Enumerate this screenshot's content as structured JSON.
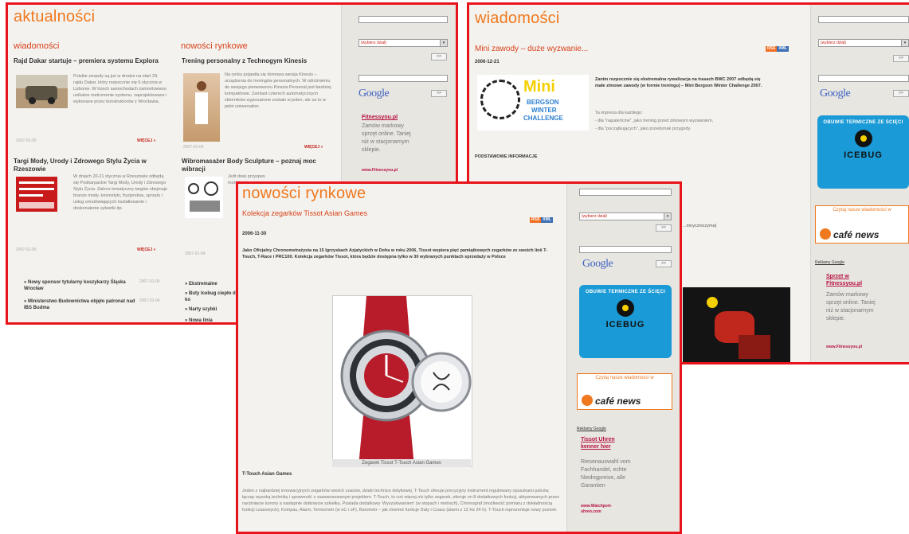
{
  "aktualnosci": {
    "title": "aktualności",
    "col_left_title": "wiadomości",
    "col_right_title": "nowości rynkowe",
    "articles_left": [
      {
        "title": "Rajd Dakar startuje – premiera systemu Explora",
        "body": "Polskie zespoły są już w drodze na start 29. rajdu Dakar, który rozpocznie się 6 stycznia w Lizbonie. W trzech samochodach zamontowano unikalne metronomie systemu, zaprojektowane i wykonane przez konstruktorów z Wrocławia.",
        "date": "2007-01-05",
        "more": "WIĘCEJ »"
      },
      {
        "title": "Targi Mody, Urody i Zdrowego Stylu Życia w Rzeszowie",
        "body": "W dniach 20-21 stycznia w Rzeszowie odbędą się Podkarpackie Targi Mody, Urody i Zdrowego Stylu Życia. Zakres tematyczny targów obejmuje branże mody, kosmetyki, fryzjerstwa, sprzętu i usług umożliwiających kształtowanie i doskonalenie sylwetki itp.",
        "date": "2007-01-05",
        "more": "WIĘCEJ »"
      }
    ],
    "articles_right": [
      {
        "title": "Trening personalny z Technogym Kinesis",
        "body": "Na rynku pojawiła się domowa wersja Kinesis – urządzenia do treningów personalnych. W odróżnieniu do swojego pierwowzoru Kinesis Personal jest bardziej kompaktowe. Zamiast czterech automatycznych zbiorników wyposażone zostało w jeden, ale za to w pełni uniwersalne.",
        "date": "2007-01-05",
        "more": "WIĘCEJ »"
      },
      {
        "title": "Wibromasażer Body Sculpture – poznaj moc wibracji",
        "body": "Jedt dowi przyspes moni trening mia ssowanie powered za pomocą po wibracji ale pomocą uny...",
        "date": "2007-01-04",
        "more": ""
      }
    ],
    "list_left": [
      {
        "text": "Nowy sponsor tytularny koszykarzy Śląska Wrocław",
        "date": "2007-01-04"
      },
      {
        "text": "Ministerstwo Budownictwa objęło patronat nad IBS Budma",
        "date": "2007-01-04"
      }
    ],
    "list_right": [
      "Ekstremalne",
      "Buty Icebug ciepło dla ko",
      "Narty szybki",
      "Nowa linia"
    ],
    "ad": {
      "link": "Fitnessyou.pl",
      "text": "Zamów markowy sprzęt online. Taniej niż w stacjonarnym sklepie.",
      "url": "www.Fitnessyou.pl"
    },
    "select_label": "(wybierz dział)",
    "go": ">>",
    "google": "Google"
  },
  "wiadomosci": {
    "title": "wiadomości",
    "article_title": "Mini zawody – duże wyzwanie...",
    "rss": [
      "RSS",
      "XML"
    ],
    "date": "2006-12-21",
    "lead": "Zanim rozpocznie się ekstremalna rywalizacja na trasach BWC 2007 odbędą się małe zimowe zawody (w formie treningu) – Mini Bergson Winter Challenge 2007.",
    "bullets": [
      "Ta impreza dla każdego:",
      "- dla \"napaleńców\", jako trening przed zimowym wyzwaniem,",
      "- dla \"początkujących\", jako przedsmak przygody."
    ],
    "section": "PODSTAWOWE INFORMACJE",
    "mini_logo": [
      "Mini",
      "BERGSON",
      "WINTER",
      "CHALLENGE"
    ],
    "icebug": {
      "top": "OBUWIE TERMICZNE ZE ŚCIĘCI",
      "brand": "ICEBUG"
    },
    "cafe": {
      "line": "Czytaj nasze wiadomości w",
      "name": "café news"
    },
    "ad_label": "Reklamy Google",
    "ad": {
      "link": "Sprzęt w Fitnessyou.pl",
      "text": "Zamów markowy sprzęt online. Taniej niż w stacjonarnym sklepie.",
      "url": "www.Fitnessyou.pl"
    },
    "partial_text": "...mnyczniczyma)"
  },
  "nowosci": {
    "title": "nowości rynkowe",
    "article_title": "Kolekcja zegarków Tissot Asian Games",
    "rss": [
      "RSS",
      "XML"
    ],
    "date": "2006-11-30",
    "lead": "Jako Oficjalny Chronometrażysta na 15 Igrzyskach Azjatyckich w Doha w roku 2006, Tissot wspiera pięć pamiątkowych zegarków ze swoich linii T-Touch, T-Race i PRC100. Kolekcja zegarków Tissot, która będzie dostępna tylko w 30 wybranych punktach sprzedaży w Polsce",
    "caption": "Zegarek Tissot T-Touch Asian Games",
    "subtitle": "T-Touch Asian Games",
    "body": "Jeden z najbardziej innowacyjnych zegarków swoich czasów, dzięki technice dotykowej, T-Touch oferuje precyzyjny instrument regulowany opuszkami palców, łącząc wysoką technikę i sprawność z zaawansowanym projektem. T-Touch, to coś więcej niż tylko zegarek, oferuje on 8 dodatkowych funkcji, aktywowanych przez naciśnięcie korony a następnie dotknięcie szkiełka. Posiada dodatkowy 'Wyszukiwaniem' (w stopach i metrach), Chronograf (możliwość pomiaru z dokładnością funkcji czasowych), Kompas, Alarm, Termometr (w oC i oF), Barometr – jak również funkcje Daty i Czasu (alarm z 12 Hz 24 h). T-Touch reprezentuje nowy poziom",
    "select_label": "(wybierz dział)",
    "go": ">>",
    "google": "Google",
    "icebug": {
      "top": "OBUWIE TERMICZNE ZE ŚCIĘCI",
      "brand": "ICEBUG"
    },
    "cafe": {
      "line": "Czytaj nasze wiadomości w",
      "name": "café news"
    },
    "ad_label": "Reklamy Google",
    "ad": {
      "link": "Tissot Uhren kenner hier",
      "text": "Riesenauswahl vom Fachhandel, echte Niedrigpreise, alle Garantien",
      "url": "www.Watchport-uhren.com"
    }
  },
  "colors": {
    "accent": "#f0781e",
    "frame": "#e8141c",
    "link": "#b8123d",
    "icebug": "#1a9ad6"
  }
}
